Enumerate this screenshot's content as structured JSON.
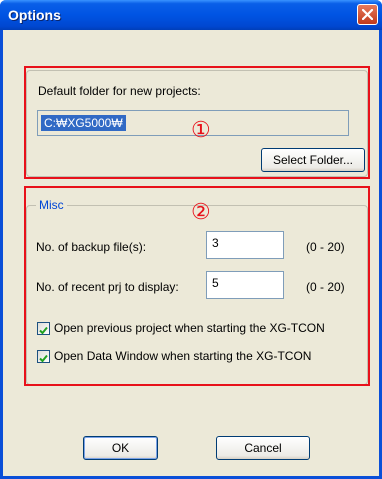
{
  "window": {
    "title": "Options"
  },
  "default_folder": {
    "label": "Default folder for new projects:",
    "path_value": "C:₩XG5000₩",
    "select_folder_label": "Select Folder..."
  },
  "misc": {
    "legend": "Misc",
    "backup_label": "No. of backup file(s):",
    "backup_value": "3",
    "backup_range": "(0 - 20)",
    "recent_label": "No. of recent prj to display:",
    "recent_value": "5",
    "recent_range": "(0 - 20)",
    "open_prev_label": "Open previous project when starting the XG-TCON",
    "open_prev_checked": true,
    "open_data_label": "Open Data Window when starting the XG-TCON",
    "open_data_checked": true
  },
  "annotations": {
    "marker_1": "①",
    "marker_2": "②",
    "color": "#e8111a"
  },
  "buttons": {
    "ok_label": "OK",
    "cancel_label": "Cancel"
  },
  "icons": {
    "close": "close-icon",
    "check": "checkmark-icon"
  }
}
